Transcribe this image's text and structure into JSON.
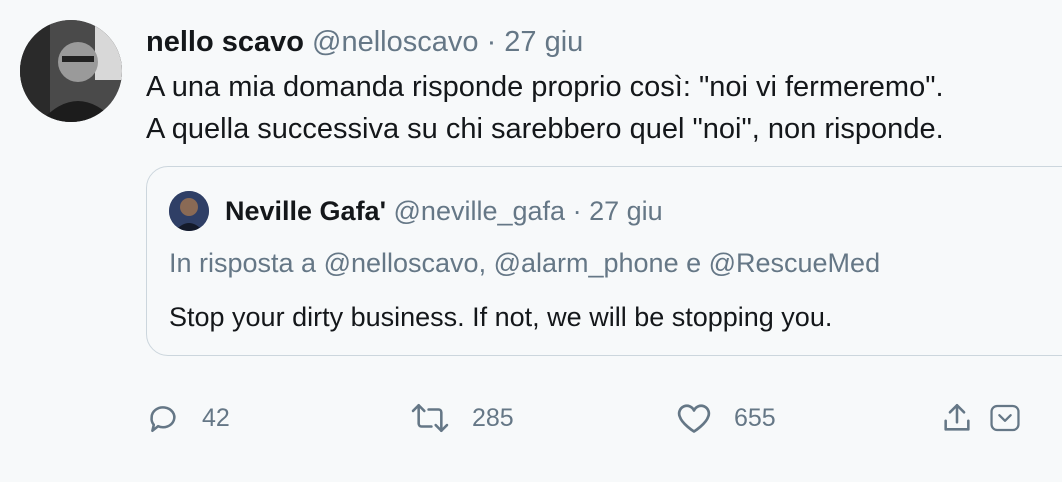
{
  "tweet": {
    "author_name": "nello scavo",
    "author_handle": "@nelloscavo",
    "separator": "·",
    "date": "27 giu",
    "text_lines": [
      "A una mia domanda risponde proprio così: \"noi vi fermeremo\".",
      "A quella successiva su chi sarebbero quel \"noi\", non risponde."
    ]
  },
  "quoted": {
    "author_name": "Neville Gafa'",
    "author_handle": "@neville_gafa",
    "separator": "·",
    "date": "27 giu",
    "reply_to": "In risposta a @nelloscavo, @alarm_phone e @RescueMed",
    "text": "Stop your dirty business. If not, we will be stopping you."
  },
  "actions": {
    "reply_count": "42",
    "retweet_count": "285",
    "like_count": "655"
  },
  "colors": {
    "background": "#f7f9fa",
    "primary_text": "#14171a",
    "secondary_text": "#657786",
    "border": "#ccd6dd"
  }
}
